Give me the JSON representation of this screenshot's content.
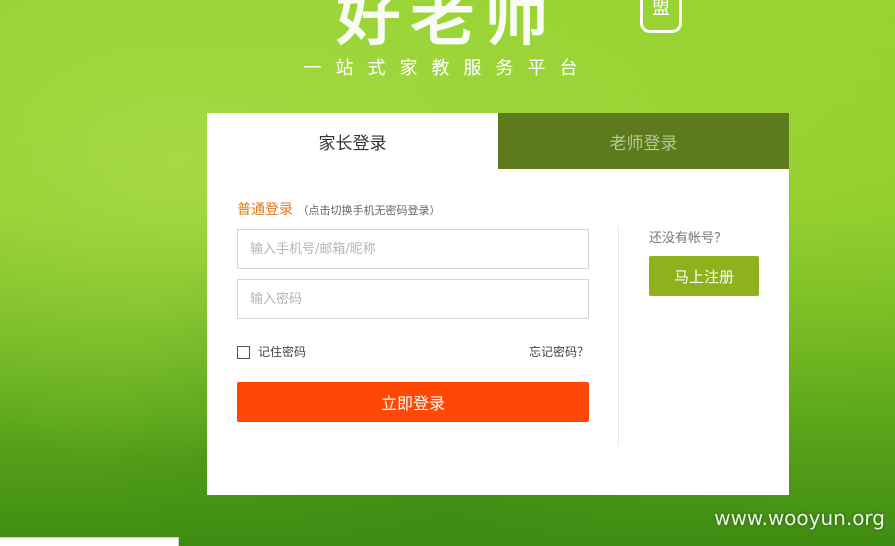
{
  "brand": {
    "logo_text": "好老师",
    "seal_text": "盟",
    "tagline": "一站式家教服务平台"
  },
  "tabs": [
    {
      "label": "家长登录",
      "active": true
    },
    {
      "label": "老师登录",
      "active": false
    }
  ],
  "login": {
    "title": "普通登录",
    "hint": "（点击切换手机无密码登录）",
    "username_placeholder": "输入手机号/邮箱/昵称",
    "password_placeholder": "输入密码",
    "remember_label": "记住密码",
    "forgot_label": "忘记密码？",
    "submit_label": "立即登录"
  },
  "register": {
    "prompt": "还没有帐号？",
    "button_label": "马上注册"
  },
  "watermark": "www.wooyun.org",
  "colors": {
    "login_button": "#ff4806",
    "register_button": "#8eb21b",
    "inactive_tab": "#5d7a1d",
    "title_accent": "#e07a1a"
  }
}
